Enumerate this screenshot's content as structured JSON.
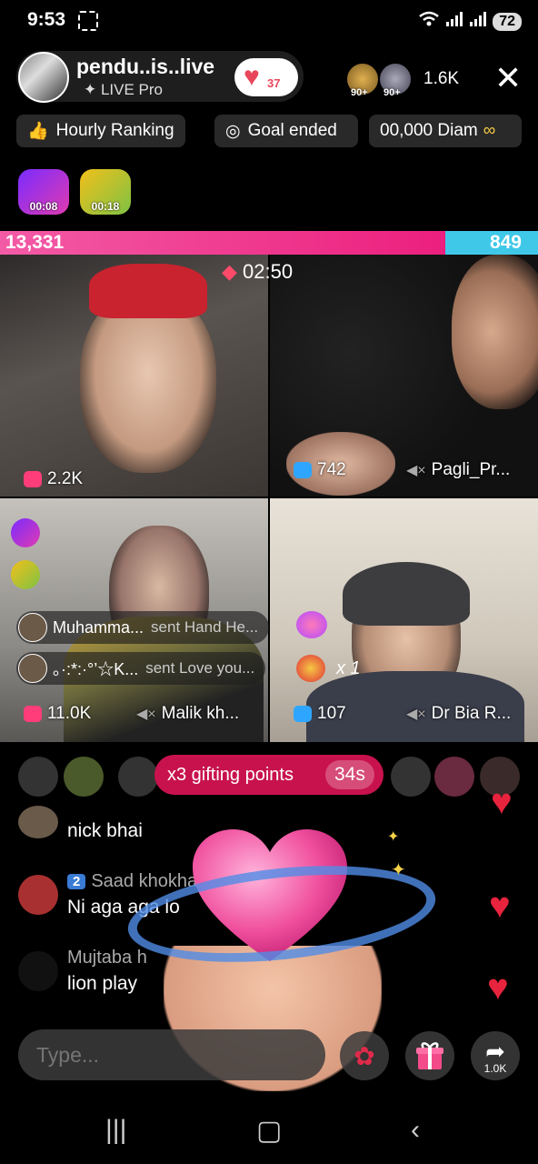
{
  "status": {
    "time": "9:53",
    "battery": "72"
  },
  "host": {
    "name": "pendu..is..live",
    "subtitle": "✦ LIVE Pro",
    "likes": "37",
    "viewer_badges": [
      "90+",
      "90+"
    ],
    "viewer_count": "1.6K"
  },
  "chips": {
    "ranking": "Hourly Ranking",
    "goal": "Goal ended",
    "diamonds": "00,000 Diam"
  },
  "boosts": [
    "00:08",
    "00:18"
  ],
  "pk": {
    "left_score": "13,331",
    "right_score": "849",
    "timer": "02:50"
  },
  "tiles": [
    {
      "stat": "2.2K",
      "name": ""
    },
    {
      "stat": "742",
      "name": "Pagli_Pr..."
    },
    {
      "stat": "11.0K",
      "name": "Malik kh..."
    },
    {
      "stat": "107",
      "name": "Dr Bia R..."
    }
  ],
  "gift_feed": [
    {
      "user": "Muhamma...",
      "text": "sent Hand He..."
    },
    {
      "user": "。·:*:·°’☆K...",
      "text": "sent Love you...",
      "multiplier": "x 1"
    }
  ],
  "gifting": {
    "label": "x3 gifting points",
    "seconds": "34s"
  },
  "comments": [
    {
      "name": "",
      "text": "nick bhai"
    },
    {
      "level": "2",
      "name": "Saad khokhar",
      "text": "Ni aga aga lo"
    },
    {
      "name": "Mujtaba h",
      "text": "lion play"
    }
  ],
  "input": {
    "placeholder": "Type..."
  },
  "share": {
    "count": "1.0K"
  },
  "colors": {
    "pk_left": "#ec1f7e",
    "pk_right": "#3fc8e8",
    "gifting": "#c8124e"
  }
}
